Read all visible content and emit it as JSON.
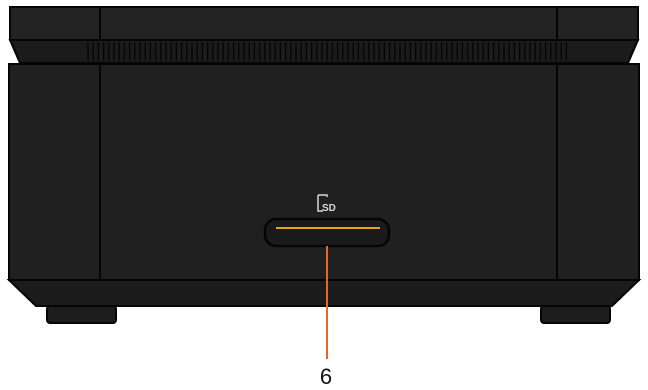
{
  "figure": {
    "slot_icon": "sd-card-icon",
    "slot_icon_text": "SD",
    "callout": "6",
    "colors": {
      "body": "#1f1f1f",
      "body_light": "#262626",
      "outline": "#050505",
      "accent": "#e8a318",
      "leader_line": "#e36a1f",
      "background": "#ffffff"
    }
  }
}
